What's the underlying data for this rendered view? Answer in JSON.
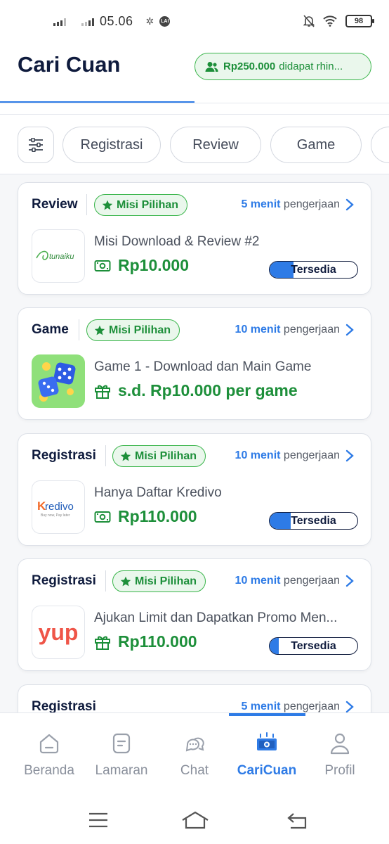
{
  "status_bar": {
    "time": "05.06",
    "badge": "LAI",
    "battery": "98"
  },
  "header": {
    "title": "Cari Cuan",
    "earn_amount": "Rp250.000",
    "earn_text": "didapat rhin..."
  },
  "filters": {
    "chips": [
      "Registrasi",
      "Review",
      "Game"
    ]
  },
  "cards": [
    {
      "category": "Review",
      "badge": "Misi Pilihan",
      "duration_value": "5 menit",
      "duration_unit": "pengerjaan",
      "logo": "tunaiku",
      "title": "Misi Download & Review #2",
      "reward": "Rp10.000",
      "reward_icon": "money-icon",
      "status": "Tersedia",
      "progress": 0.27
    },
    {
      "category": "Game",
      "badge": "Misi Pilihan",
      "duration_value": "10 menit",
      "duration_unit": "pengerjaan",
      "logo": "dice",
      "title": "Game 1 - Download dan Main Game",
      "reward": "s.d. Rp10.000 per game",
      "reward_icon": "gift-icon",
      "status": "",
      "progress": 0
    },
    {
      "category": "Registrasi",
      "badge": "Misi Pilihan",
      "duration_value": "10 menit",
      "duration_unit": "pengerjaan",
      "logo": "Kredivo",
      "logo_tagline": "Buy now, Pay later",
      "title": "Hanya Daftar Kredivo",
      "reward": "Rp110.000",
      "reward_icon": "money-icon",
      "status": "Tersedia",
      "progress": 0.24
    },
    {
      "category": "Registrasi",
      "badge": "Misi Pilihan",
      "duration_value": "10 menit",
      "duration_unit": "pengerjaan",
      "logo": "yup",
      "title": "Ajukan Limit dan Dapatkan Promo Men...",
      "reward": "Rp110.000",
      "reward_icon": "gift-icon",
      "status": "Tersedia",
      "progress": 0.1
    },
    {
      "category": "Registrasi",
      "badge": "",
      "duration_value": "5 menit",
      "duration_unit": "pengerjaan",
      "title": "",
      "reward": "",
      "status": "",
      "progress": 0
    }
  ],
  "bottom_nav": [
    {
      "label": "Beranda",
      "icon": "home-icon"
    },
    {
      "label": "Lamaran",
      "icon": "document-icon"
    },
    {
      "label": "Chat",
      "icon": "chat-icon"
    },
    {
      "label": "CariCuan",
      "icon": "money-coin-icon",
      "active": true
    },
    {
      "label": "Profil",
      "icon": "user-icon"
    }
  ],
  "colors": {
    "accent": "#2e7be6",
    "green": "#1d8f3a",
    "navy": "#0f1b3d"
  }
}
